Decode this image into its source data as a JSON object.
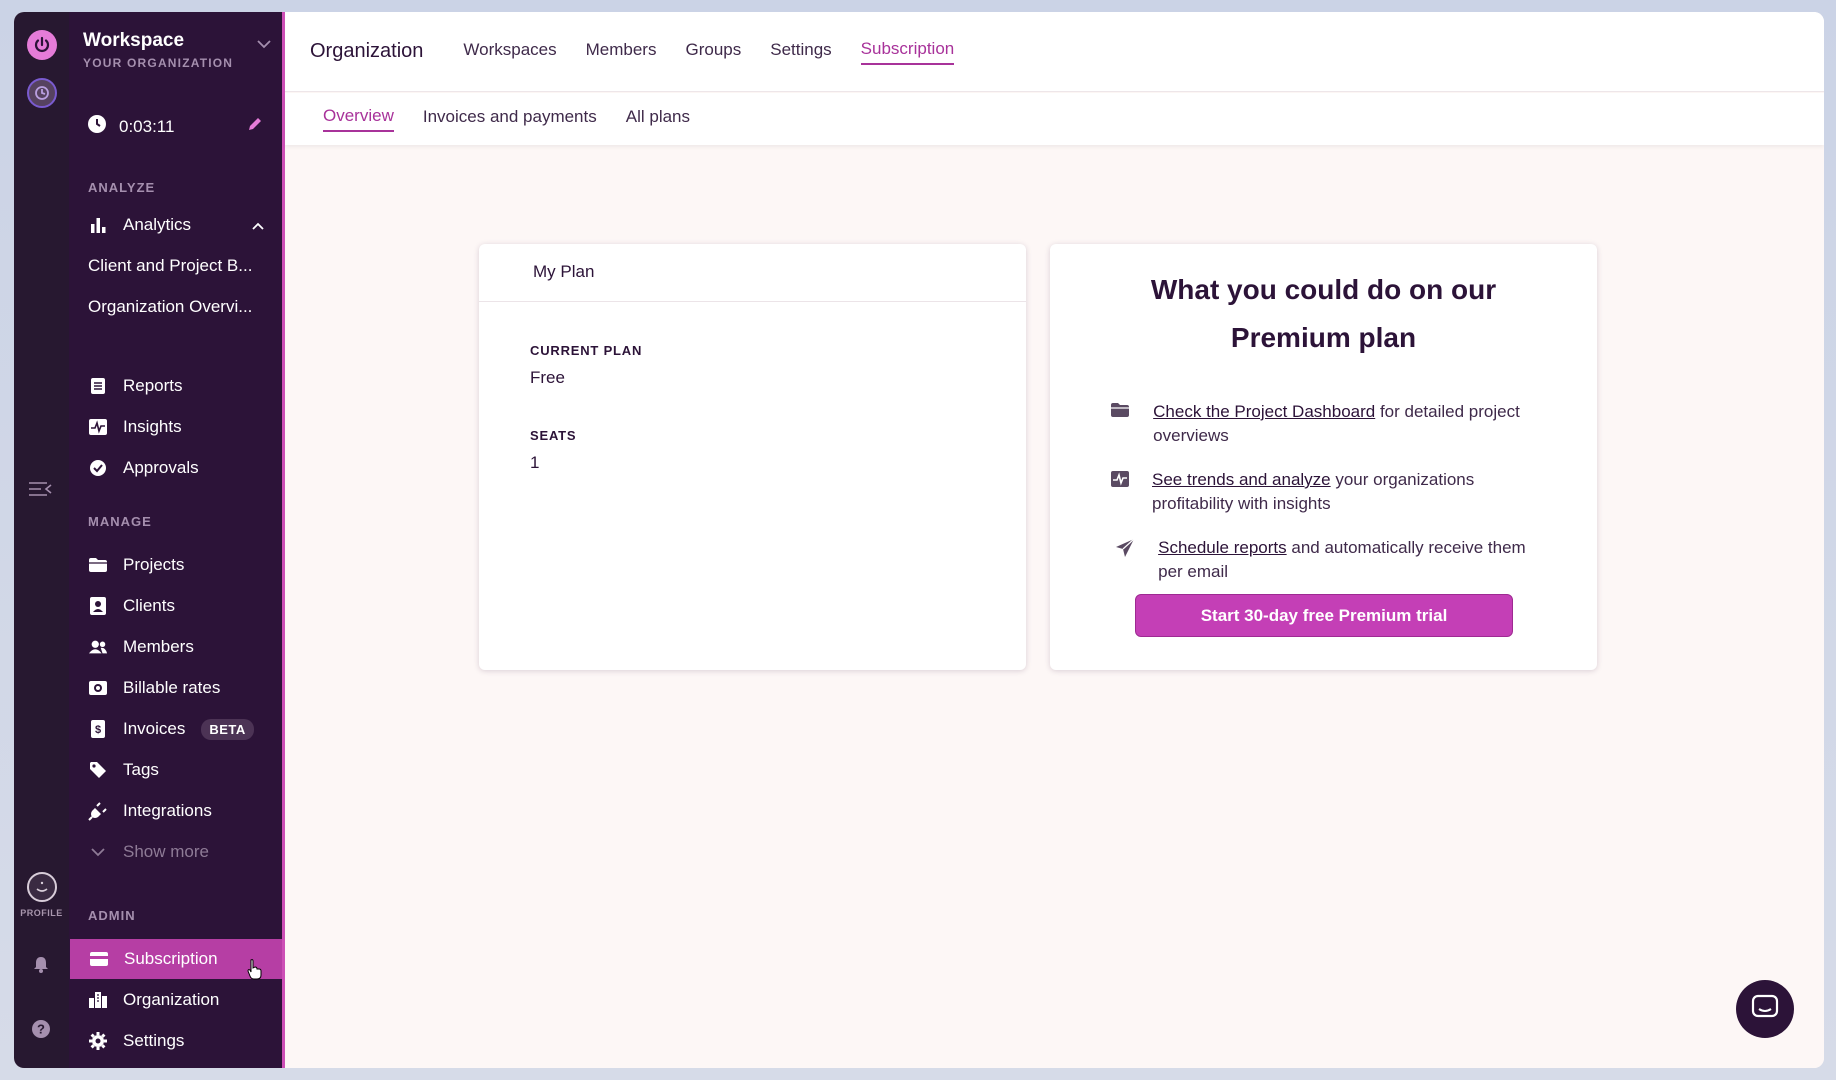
{
  "sidebar": {
    "workspace_name": "Workspace",
    "workspace_sub": "YOUR ORGANIZATION",
    "timer": "0:03:11",
    "sections": {
      "analyze": "ANALYZE",
      "manage": "MANAGE",
      "admin": "ADMIN"
    },
    "analyze_items": [
      {
        "label": "Analytics",
        "icon": "bar-chart-icon"
      },
      {
        "label": "Client and Project B..."
      },
      {
        "label": "Organization Overvi..."
      },
      {
        "label": "Reports",
        "icon": "document-icon"
      },
      {
        "label": "Insights",
        "icon": "pulse-icon"
      },
      {
        "label": "Approvals",
        "icon": "check-circle-icon"
      }
    ],
    "manage_items": [
      {
        "label": "Projects",
        "icon": "folder-icon"
      },
      {
        "label": "Clients",
        "icon": "client-card-icon"
      },
      {
        "label": "Members",
        "icon": "people-icon"
      },
      {
        "label": "Billable rates",
        "icon": "money-icon"
      },
      {
        "label": "Invoices",
        "icon": "invoice-icon",
        "badge": "BETA"
      },
      {
        "label": "Tags",
        "icon": "tag-icon"
      },
      {
        "label": "Integrations",
        "icon": "plug-icon"
      },
      {
        "label": "Show more",
        "icon": "chevron-down-icon"
      }
    ],
    "admin_items": [
      {
        "label": "Subscription",
        "icon": "card-icon",
        "active": true
      },
      {
        "label": "Organization",
        "icon": "building-icon"
      },
      {
        "label": "Settings",
        "icon": "gear-icon"
      }
    ],
    "profile_label": "PROFILE"
  },
  "topbar": {
    "title": "Organization",
    "tabs": [
      "Workspaces",
      "Members",
      "Groups",
      "Settings",
      "Subscription"
    ],
    "active_tab": "Subscription"
  },
  "subtabs": {
    "tabs": [
      "Overview",
      "Invoices and payments",
      "All plans"
    ],
    "active": "Overview"
  },
  "plan_card": {
    "title": "My Plan",
    "current_plan_label": "CURRENT PLAN",
    "current_plan_value": "Free",
    "seats_label": "SEATS",
    "seats_value": "1"
  },
  "premium_card": {
    "title_line1": "What you could do on our",
    "title_line2": "Premium plan",
    "features": [
      {
        "link": "Check the Project Dashboard",
        "rest": " for detailed project overviews",
        "icon": "folder-icon"
      },
      {
        "link": "See trends and analyze",
        "rest": " your organizations profitability with insights",
        "icon": "pulse-icon"
      },
      {
        "link": "Schedule reports",
        "rest": " and automatically receive them per email",
        "icon": "paper-plane-icon"
      }
    ],
    "button_label": "Start 30-day free Premium trial"
  },
  "colors": {
    "sidebar_bg": "#2c1338",
    "accent": "#c43fb6",
    "active_tab": "#a8329a"
  }
}
